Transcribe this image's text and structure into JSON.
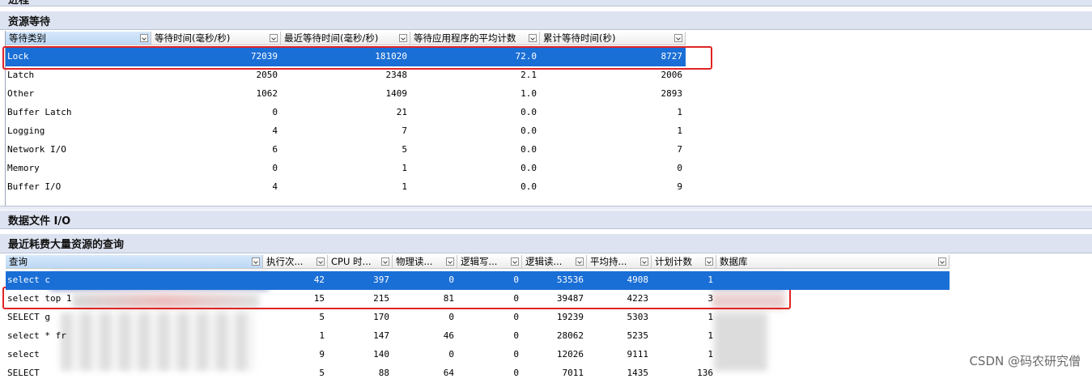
{
  "top_bar": {
    "label": "进程"
  },
  "wait_section": {
    "title": "资源等待",
    "columns": [
      "等待类别",
      "等待时间(毫秒/秒)",
      "最近等待时间(毫秒/秒)",
      "等待应用程序的平均计数",
      "累计等待时间(秒)"
    ],
    "rows": [
      [
        "Lock",
        "72039",
        "181020",
        "72.0",
        "8727"
      ],
      [
        "Latch",
        "2050",
        "2348",
        "2.1",
        "2006"
      ],
      [
        "Other",
        "1062",
        "1409",
        "1.0",
        "2893"
      ],
      [
        "Buffer Latch",
        "0",
        "21",
        "0.0",
        "1"
      ],
      [
        "Logging",
        "4",
        "7",
        "0.0",
        "1"
      ],
      [
        "Network I/O",
        "6",
        "5",
        "0.0",
        "7"
      ],
      [
        "Memory",
        "0",
        "1",
        "0.0",
        "0"
      ],
      [
        "Buffer I/O",
        "4",
        "1",
        "0.0",
        "9"
      ]
    ],
    "selected_row": 0
  },
  "file_io_section": {
    "title": "数据文件 I/O"
  },
  "query_section": {
    "title": "最近耗费大量资源的查询",
    "columns": [
      "查询",
      "执行次...",
      "CPU 时...",
      "物理读...",
      "逻辑写...",
      "逻辑读...",
      "平均持...",
      "计划计数",
      "数据库"
    ],
    "rows": [
      [
        "select c",
        "42",
        "397",
        "0",
        "0",
        "53536",
        "4908",
        "1",
        ""
      ],
      [
        "select top 1",
        "15",
        "215",
        "81",
        "0",
        "39487",
        "4223",
        "3",
        ""
      ],
      [
        "SELECT g",
        "5",
        "170",
        "0",
        "0",
        "19239",
        "5303",
        "1",
        ""
      ],
      [
        "select * fr",
        "1",
        "147",
        "46",
        "0",
        "28062",
        "5235",
        "1",
        ""
      ],
      [
        "select ",
        "9",
        "140",
        "0",
        "0",
        "12026",
        "9111",
        "1",
        ""
      ],
      [
        "SELECT ",
        "5",
        "88",
        "64",
        "0",
        "7011",
        "1435",
        "136",
        ""
      ]
    ],
    "selected_row": 0
  },
  "watermark": "CSDN @码农研究僧",
  "colors": {
    "selection": "#1a6fd6",
    "highlight_box": "#e02424",
    "section_bar": "#dde3f0"
  }
}
